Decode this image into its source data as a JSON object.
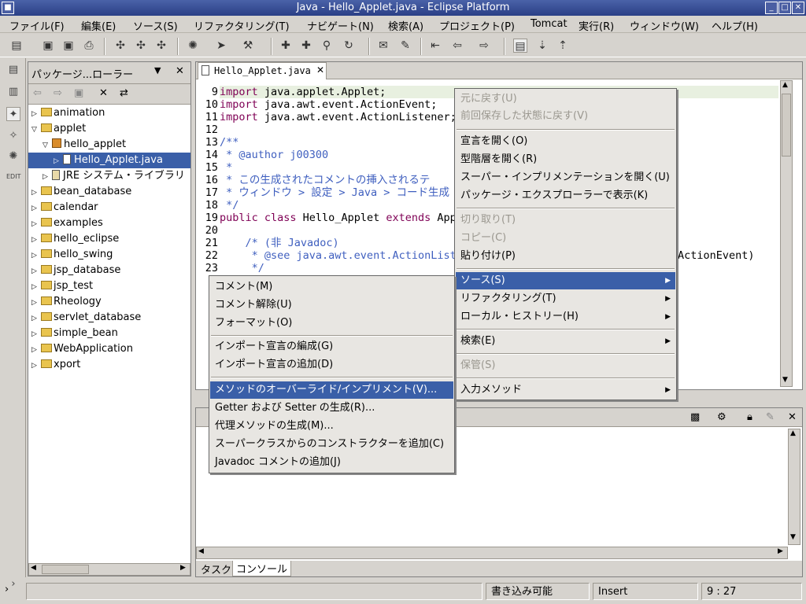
{
  "window": {
    "title": "Java - Hello_Applet.java - Eclipse Platform"
  },
  "menubar": [
    "ファイル(F)",
    "編集(E)",
    "ソース(S)",
    "リファクタリング(T)",
    "ナビゲート(N)",
    "検索(A)",
    "プロジェクト(P)",
    "Tomcat",
    "実行(R)",
    "ウィンドウ(W)",
    "ヘルプ(H)"
  ],
  "package_explorer": {
    "title": "パッケージ...ローラー",
    "items": [
      "animation",
      "applet",
      "hello_applet",
      "Hello_Applet.java",
      "JRE システム・ライブラリ",
      "bean_database",
      "calendar",
      "examples",
      "hello_eclipse",
      "hello_swing",
      "jsp_database",
      "jsp_test",
      "Rheology",
      "servlet_database",
      "simple_bean",
      "WebApplication",
      "xport"
    ]
  },
  "editor": {
    "tab": "Hello_Applet.java",
    "line_numbers": [
      "9",
      "10",
      "11",
      "12",
      "13",
      "14",
      "15",
      "16",
      "17",
      "18",
      "19",
      "20",
      "21",
      "22",
      "23"
    ],
    "lines": [
      {
        "kw": "import",
        "rest": " java.applet.Applet;"
      },
      {
        "kw": "import",
        "rest": " java.awt.event.ActionEvent;"
      },
      {
        "kw": "import",
        "rest": " java.awt.event.ActionListener;"
      },
      {
        "cm": ""
      },
      {
        "cm": "/**"
      },
      {
        "cm": " * @author j00300"
      },
      {
        "cm": " *"
      },
      {
        "cm": " * この生成されたコメントの挿入されるテ"
      },
      {
        "cm": " * ウィンドウ > 設定 > Java > コード生成"
      },
      {
        "cm": " */"
      },
      {
        "kw": "public class",
        "rest": " Hello_Applet ",
        "kw2": "extends",
        "rest2": " App"
      },
      {
        "cm": ""
      },
      {
        "cm": "    /* (非 Javadoc)"
      },
      {
        "cm": "     * @see java.awt.event.ActionListe"
      },
      {
        "cm": "     */"
      }
    ],
    "overflow_text": "ActionEvent)"
  },
  "context_menu": {
    "items": [
      "元に戻す(U)",
      "前回保存した状態に戻す(V)",
      "宣言を開く(O)",
      "型階層を開く(R)",
      "スーパー・インプリメンテーションを開く(U)",
      "パッケージ・エクスプローラーで表示(K)",
      "切り取り(T)",
      "コピー(C)",
      "貼り付け(P)",
      "ソース(S)",
      "リファクタリング(T)",
      "ローカル・ヒストリー(H)",
      "検索(E)",
      "保管(S)",
      "入力メソッド"
    ]
  },
  "source_submenu": {
    "items": [
      "コメント(M)",
      "コメント解除(U)",
      "フォーマット(O)",
      "インポート宣言の編成(G)",
      "インポート宣言の追加(D)",
      "メソッドのオーバーライド/インプリメント(V)...",
      "Getter および Setter の生成(R)...",
      "代理メソッドの生成(M)...",
      "スーパークラスからのコンストラクターを追加(C)",
      "Javadoc コメントの追加(J)"
    ]
  },
  "bottom_tabs": [
    "タスク",
    "コンソール"
  ],
  "status": {
    "writable": "書き込み可能",
    "mode": "Insert",
    "position": "9 : 27"
  }
}
